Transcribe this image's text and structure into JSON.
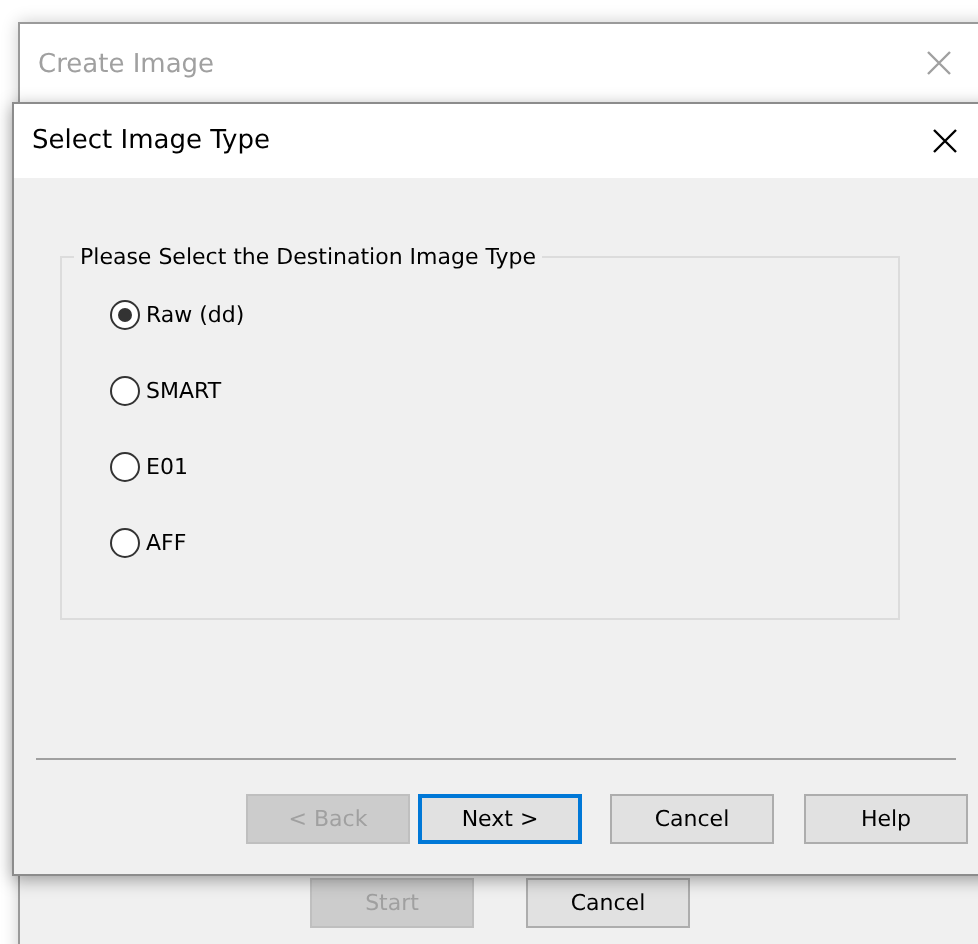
{
  "background_window": {
    "title": "Create Image",
    "buttons": [
      {
        "label": "Start",
        "disabled": true
      },
      {
        "label": "Cancel",
        "disabled": false
      }
    ]
  },
  "dialog": {
    "title": "Select Image Type",
    "group_label": "Please Select the Destination Image Type",
    "options": [
      {
        "label": "Raw (dd)",
        "selected": true
      },
      {
        "label": "SMART",
        "selected": false
      },
      {
        "label": "E01",
        "selected": false
      },
      {
        "label": "AFF",
        "selected": false
      }
    ],
    "buttons": [
      {
        "label": "< Back",
        "disabled": true,
        "default": false
      },
      {
        "label": "Next >",
        "disabled": false,
        "default": true
      },
      {
        "label": "Cancel",
        "disabled": false,
        "default": false
      },
      {
        "label": "Help",
        "disabled": false,
        "default": false
      }
    ]
  }
}
